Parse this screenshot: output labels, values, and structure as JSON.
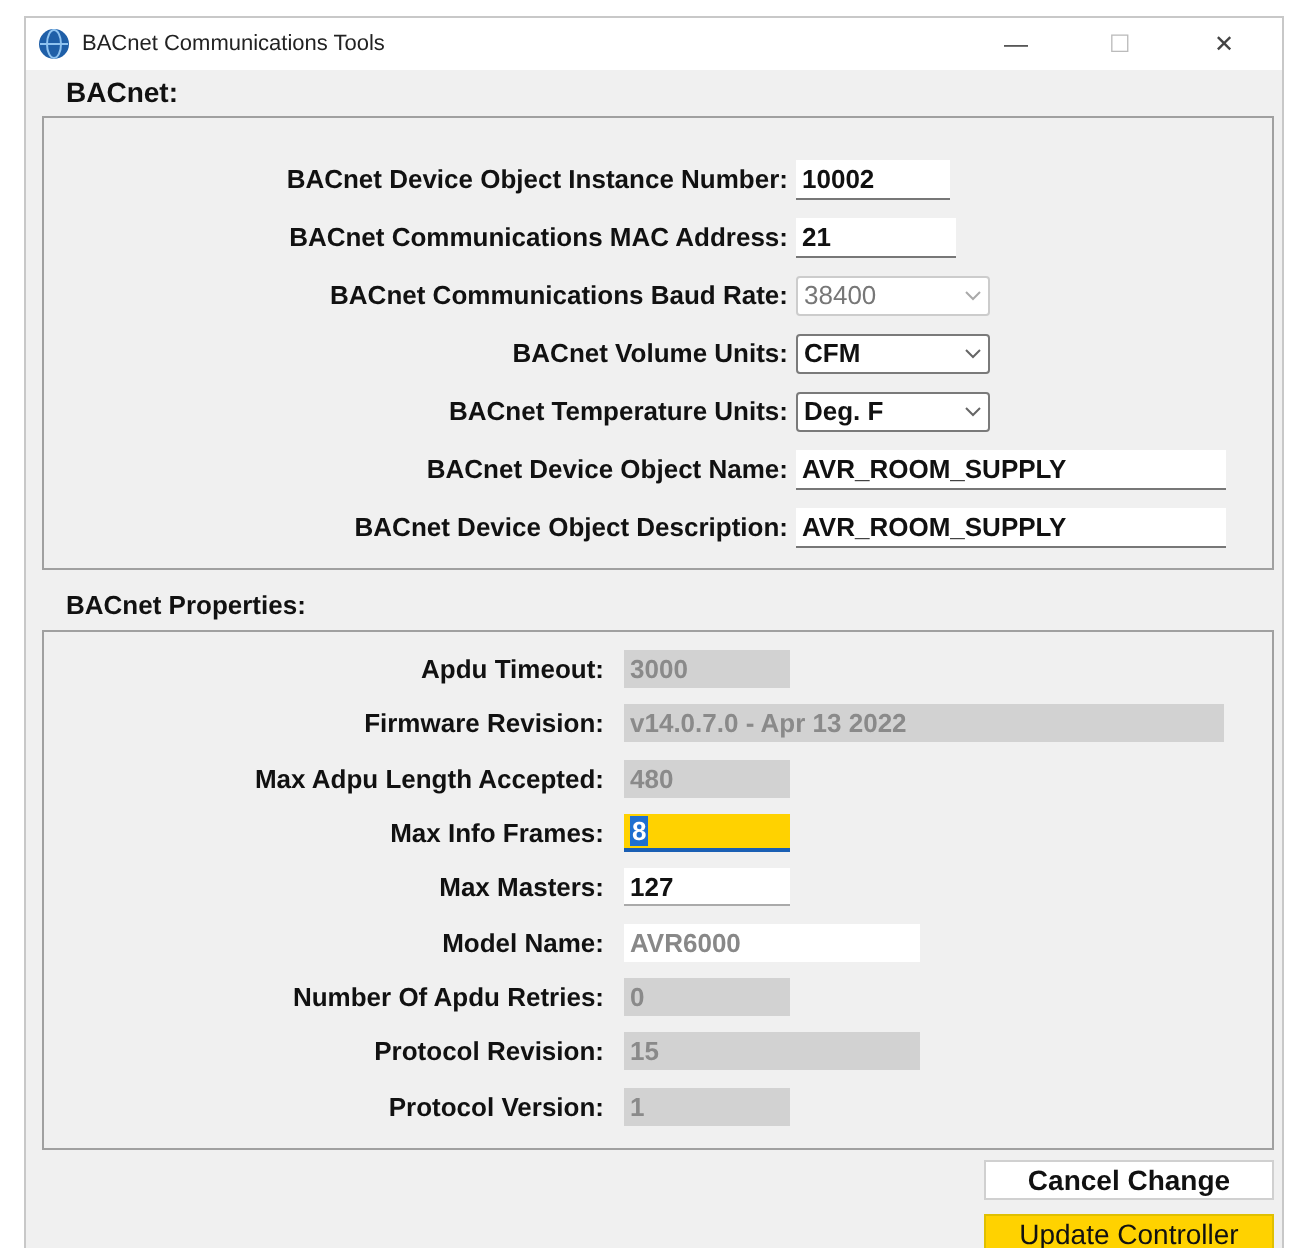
{
  "window": {
    "title": "BACnet Communications Tools",
    "controls": [
      "—",
      "☐",
      "✕"
    ]
  },
  "bacnet": {
    "title": "BACnet:",
    "fields": [
      {
        "label": "BACnet Device Object Instance Number:",
        "value": "10002",
        "kind": "text",
        "disabled": false
      },
      {
        "label": "BACnet Communications MAC Address:",
        "value": "21",
        "kind": "text",
        "disabled": false
      },
      {
        "label": "BACnet Communications Baud Rate:",
        "value": "38400",
        "kind": "dropdown",
        "disabled": true
      },
      {
        "label": "BACnet Volume Units:",
        "value": "CFM",
        "kind": "dropdown",
        "disabled": false
      },
      {
        "label": "BACnet Temperature Units:",
        "value": "Deg. F",
        "kind": "dropdown",
        "disabled": false
      },
      {
        "label": "BACnet Device Object Name:",
        "value": "AVR_ROOM_SUPPLY",
        "kind": "text",
        "disabled": false
      },
      {
        "label": "BACnet Device Object Description:",
        "value": "AVR_ROOM_SUPPLY",
        "kind": "text",
        "disabled": false
      }
    ]
  },
  "properties": {
    "title": "BACnet Properties:",
    "fields": [
      {
        "label": "Apdu Timeout:",
        "value": "3000",
        "disabled": true,
        "readonly": false,
        "focused": false
      },
      {
        "label": "Firmware Revision:",
        "value": "v14.0.7.0 - Apr 13 2022",
        "disabled": true,
        "readonly": false,
        "focused": false
      },
      {
        "label": "Max Adpu Length Accepted:",
        "value": "480",
        "disabled": true,
        "readonly": false,
        "focused": false
      },
      {
        "label": "Max Info Frames:",
        "value": "8",
        "disabled": false,
        "readonly": false,
        "focused": true
      },
      {
        "label": "Max Masters:",
        "value": "127",
        "disabled": false,
        "readonly": false,
        "focused": false
      },
      {
        "label": "Model Name:",
        "value": "AVR6000",
        "disabled": false,
        "readonly": true,
        "focused": false
      },
      {
        "label": "Number Of Apdu Retries:",
        "value": "0",
        "disabled": true,
        "readonly": false,
        "focused": false
      },
      {
        "label": "Protocol Revision:",
        "value": "15",
        "disabled": true,
        "readonly": false,
        "focused": false
      },
      {
        "label": "Protocol Version:",
        "value": "1",
        "disabled": true,
        "readonly": false,
        "focused": false
      }
    ]
  },
  "buttons": [
    {
      "label": "Cancel Change",
      "primary": false
    },
    {
      "label": "Update Controller",
      "primary": true
    }
  ]
}
